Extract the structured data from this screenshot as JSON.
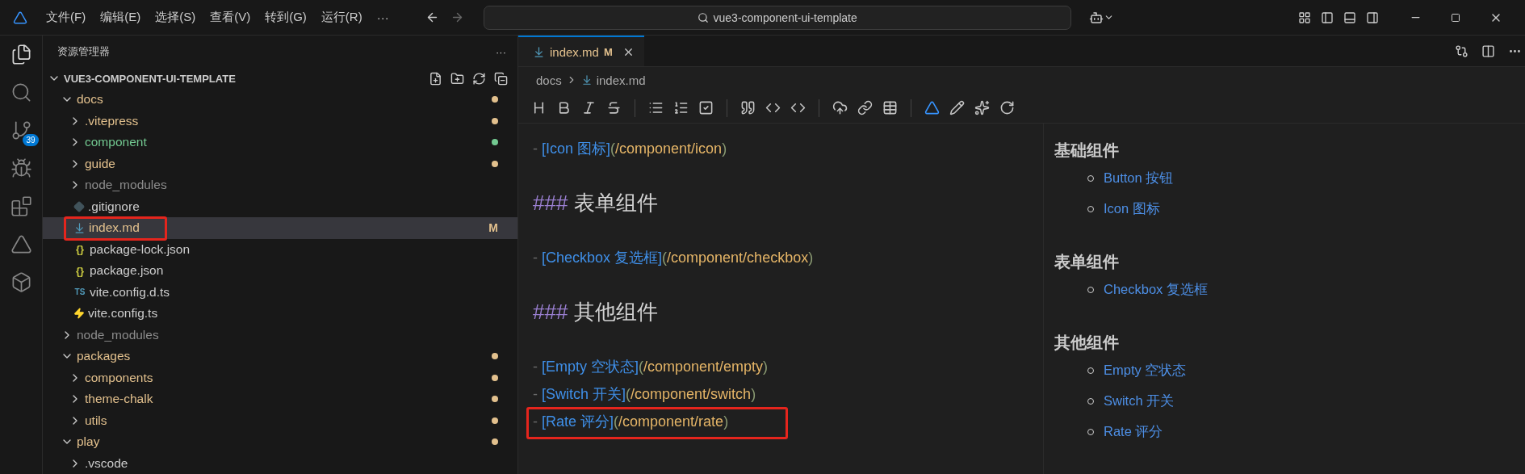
{
  "title_bar": {
    "menus": [
      "文件(F)",
      "编辑(E)",
      "选择(S)",
      "查看(V)",
      "转到(G)",
      "运行(R)"
    ],
    "more": "···",
    "search": "vue3-component-ui-template"
  },
  "activity_bar": [
    {
      "kind": "files",
      "selected": true
    },
    {
      "kind": "search",
      "selected": false
    },
    {
      "kind": "source-control",
      "selected": false,
      "badge": "39"
    },
    {
      "kind": "debug",
      "selected": false
    },
    {
      "kind": "extensions",
      "selected": false
    },
    {
      "kind": "triangle",
      "selected": false
    },
    {
      "kind": "cube",
      "selected": false
    }
  ],
  "sidebar": {
    "title": "资源管理器",
    "more": "···",
    "root": "VUE3-COMPONENT-UI-TEMPLATE",
    "tree": [
      {
        "name": "docs",
        "kind": "folder",
        "expanded": true,
        "color": "#e2c08d",
        "dot": true,
        "selected": false,
        "children": [
          {
            "name": ".vitepress",
            "kind": "folder",
            "expanded": false,
            "color": "#e2c08d",
            "dot": true,
            "selected": false
          },
          {
            "name": "component",
            "kind": "folder",
            "expanded": false,
            "color": "#73c991",
            "dot": true,
            "selected": false
          },
          {
            "name": "guide",
            "kind": "folder",
            "expanded": false,
            "color": "#e2c08d",
            "dot": true,
            "selected": false
          },
          {
            "name": "node_modules",
            "kind": "folder",
            "expanded": false,
            "color": "#8c8c8c",
            "dot": false,
            "selected": false
          },
          {
            "name": ".gitignore",
            "kind": "git",
            "color": "#cccccc",
            "dot": false,
            "selected": false
          },
          {
            "name": "index.md",
            "kind": "markdown",
            "color": "#e2c08d",
            "dot": false,
            "badge": "M",
            "selected": true,
            "annotated": true
          },
          {
            "name": "package-lock.json",
            "kind": "json",
            "glyph": "{}",
            "color": "#cccccc",
            "dot": false,
            "selected": false
          },
          {
            "name": "package.json",
            "kind": "json",
            "glyph": "{}",
            "color": "#cccccc",
            "dot": false,
            "selected": false
          },
          {
            "name": "vite.config.d.ts",
            "kind": "typescript",
            "glyph": "TS",
            "color": "#cccccc",
            "dot": false,
            "selected": false
          },
          {
            "name": "vite.config.ts",
            "kind": "vite",
            "color": "#cccccc",
            "dot": false,
            "selected": false
          }
        ]
      },
      {
        "name": "node_modules",
        "kind": "folder",
        "expanded": false,
        "color": "#8c8c8c",
        "dot": false,
        "selected": false
      },
      {
        "name": "packages",
        "kind": "folder",
        "expanded": true,
        "color": "#e2c08d",
        "dot": true,
        "selected": false,
        "children": [
          {
            "name": "components",
            "kind": "folder",
            "expanded": false,
            "color": "#e2c08d",
            "dot": true,
            "selected": false
          },
          {
            "name": "theme-chalk",
            "kind": "folder",
            "expanded": false,
            "color": "#e2c08d",
            "dot": true,
            "selected": false
          },
          {
            "name": "utils",
            "kind": "folder",
            "expanded": false,
            "color": "#e2c08d",
            "dot": true,
            "selected": false
          }
        ]
      },
      {
        "name": "play",
        "kind": "folder",
        "expanded": true,
        "color": "#e2c08d",
        "dot": true,
        "selected": false,
        "children": [
          {
            "name": ".vscode",
            "kind": "folder",
            "expanded": false,
            "color": "#cccccc",
            "dot": false,
            "selected": false
          }
        ]
      }
    ]
  },
  "tab": {
    "name": "index.md",
    "badge": "M",
    "selected": true
  },
  "breadcrumb": [
    "docs",
    "index.md"
  ],
  "editor_lines": [
    {
      "kind": "link",
      "bullet": "-",
      "label": "[Icon 图标]",
      "url": "(/component/icon)"
    },
    {
      "kind": "blank"
    },
    {
      "kind": "heading",
      "marker": "###",
      "text": "表单组件"
    },
    {
      "kind": "blank"
    },
    {
      "kind": "link",
      "bullet": "-",
      "label": "[Checkbox 复选框]",
      "url": "(/component/checkbox)"
    },
    {
      "kind": "blank"
    },
    {
      "kind": "heading",
      "marker": "###",
      "text": "其他组件"
    },
    {
      "kind": "blank"
    },
    {
      "kind": "link",
      "bullet": "-",
      "label": "[Empty 空状态]",
      "url": "(/component/empty)"
    },
    {
      "kind": "link",
      "bullet": "-",
      "label": "[Switch 开关]",
      "url": "(/component/switch)"
    },
    {
      "kind": "link",
      "bullet": "-",
      "label": "[Rate 评分]",
      "url": "(/component/rate)",
      "annotated": true
    }
  ],
  "preview": [
    {
      "heading": "基础组件",
      "items": [
        "Button 按钮",
        "Icon 图标"
      ]
    },
    {
      "heading": "表单组件",
      "items": [
        "Checkbox 复选框"
      ]
    },
    {
      "heading": "其他组件",
      "items": [
        "Empty 空状态",
        "Switch 开关",
        "Rate 评分"
      ]
    }
  ]
}
